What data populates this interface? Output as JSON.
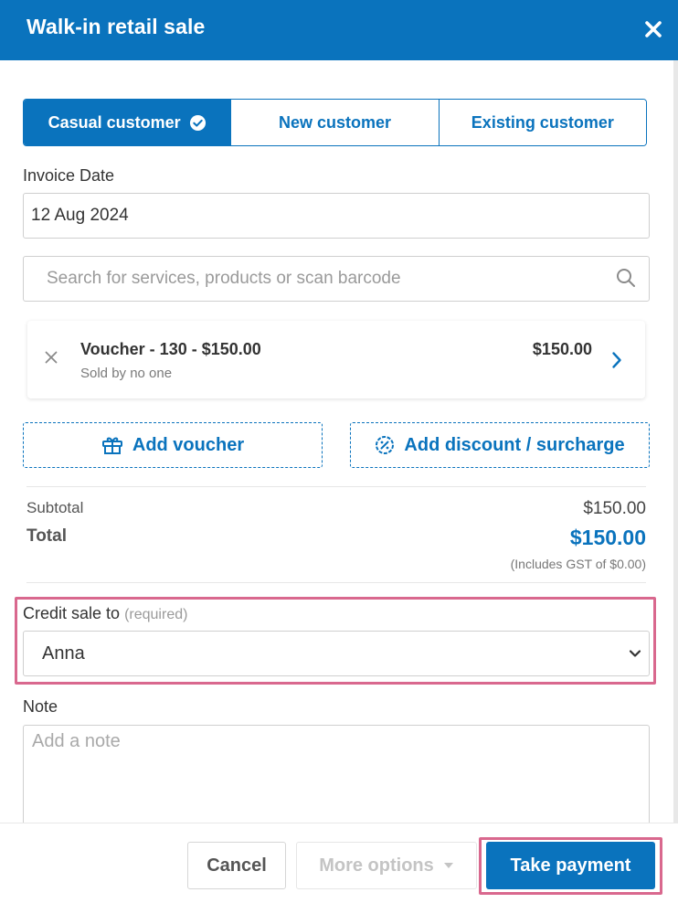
{
  "header": {
    "title": "Walk-in retail sale",
    "close_icon": "close-icon"
  },
  "customer_type": {
    "options": [
      "Casual customer",
      "New customer",
      "Existing customer"
    ],
    "selected": "Casual customer"
  },
  "invoice_date": {
    "label": "Invoice Date",
    "value": "12 Aug 2024"
  },
  "search": {
    "placeholder": "Search for services, products or scan barcode",
    "icon": "search-icon"
  },
  "line_item": {
    "name": "Voucher - 130 - $150.00",
    "sold_by": "Sold by no one",
    "price": "$150.00"
  },
  "actions": {
    "add_voucher": "Add voucher",
    "add_discount": "Add discount / surcharge"
  },
  "summary": {
    "subtotal_label": "Subtotal",
    "subtotal_value": "$150.00",
    "total_label": "Total",
    "total_value": "$150.00",
    "gst_note": "(Includes GST of $0.00)"
  },
  "credit_sale": {
    "label": "Credit sale to",
    "required": "(required)",
    "selected": "Anna"
  },
  "note": {
    "label": "Note",
    "placeholder": "Add a note"
  },
  "footer": {
    "cancel": "Cancel",
    "more_options": "More options",
    "take_payment": "Take payment"
  },
  "colors": {
    "brand": "#0a73bd",
    "highlight": "#d9688e"
  }
}
